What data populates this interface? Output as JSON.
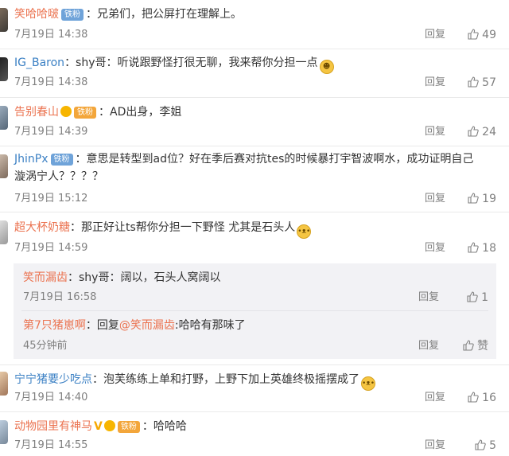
{
  "comments": [
    {
      "user": "笑哈哈啵",
      "badge": "铁粉",
      "text": "：兄弟们，把公屏打在理解上。",
      "time": "7月19日 14:38",
      "reply": "回复",
      "likes": "49"
    },
    {
      "user": "IG_Baron",
      "text": "：shy哥：听说跟野怪打很无聊，我来帮你分担一点",
      "time": "7月19日 14:38",
      "reply": "回复",
      "likes": "57"
    },
    {
      "user": "告别春山",
      "badge": "铁粉",
      "text": "：AD出身，李姐",
      "time": "7月19日 14:39",
      "reply": "回复",
      "likes": "24"
    },
    {
      "user": "JhinPx",
      "badge": "铁粉",
      "text": "：意思是转型到ad位？好在季后赛对抗tes的时候暴打宇智波啊水，成功证明自己",
      "text2": "漩涡宁人？？？？",
      "time": "7月19日 15:12",
      "reply": "回复",
      "likes": "19"
    },
    {
      "user": "超大杯奶糖",
      "text": "：那正好让ts帮你分担一下野怪 尤其是石头人",
      "time": "7月19日 14:59",
      "reply": "回复",
      "likes": "18"
    },
    {
      "user": "宁宁猪要少吃点",
      "text": "：泡芙练练上单和打野，上野下加上英雄终极摇摆成了",
      "time": "7月19日 14:40",
      "reply": "回复",
      "likes": "16"
    },
    {
      "user": "动物园里有神马",
      "badge": "铁粉",
      "vmark": "V",
      "text": "：哈哈哈",
      "time": "7月19日 14:55",
      "reply": "回复",
      "likes": "5"
    }
  ],
  "subreplies": [
    {
      "user": "笑而漏齿",
      "text": "：shy哥：阔以，石头人窝阔以",
      "time": "7月19日 16:58",
      "reply": "回复",
      "likes": "1"
    },
    {
      "user": "第7只猪崽啊",
      "text_pre": "：回复",
      "mention": "@笑而漏齿",
      "text": ":哈哈有那味了",
      "time": "45分钟前",
      "reply": "回复",
      "likes": "赞"
    }
  ]
}
